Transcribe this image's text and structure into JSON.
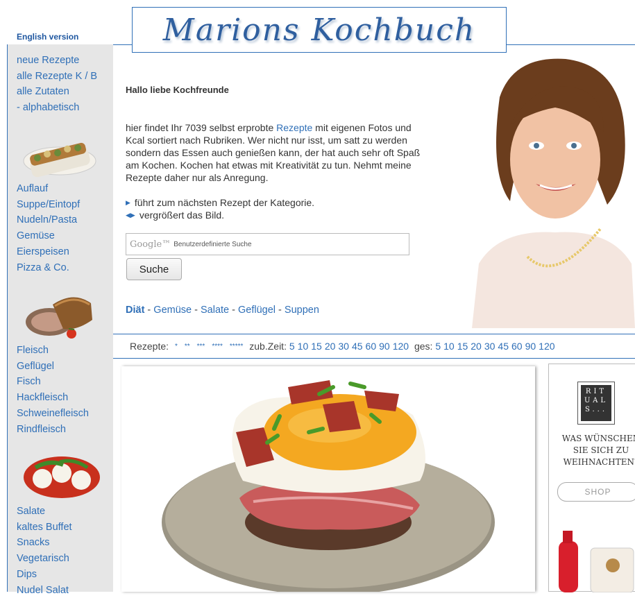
{
  "english_link": "English version",
  "logo_title": "Marions Kochbuch",
  "sidebar": {
    "group1": [
      "neue Rezepte",
      "alle Rezepte K / B",
      "alle Zutaten",
      "- alphabetisch"
    ],
    "group2": [
      "Auflauf",
      "Suppe/Eintopf",
      "Nudeln/Pasta",
      "Gemüse",
      "Eierspeisen",
      "Pizza & Co."
    ],
    "group3": [
      "Fleisch",
      "Geflügel",
      "Fisch",
      "Hackfleisch",
      "Schweinefleisch",
      "Rindfleisch"
    ],
    "group4": [
      "Salate",
      "kaltes Buffet",
      "Snacks",
      "Vegetarisch",
      "Dips",
      "Nudel Salat"
    ]
  },
  "main": {
    "greeting": "Hallo liebe Kochfreunde",
    "intro_before": "hier findet Ihr 7039 selbst erprobte ",
    "intro_link": "Rezepte",
    "intro_after": " mit eigenen Fotos und Kcal sortiert nach Rubriken. Wer nicht nur isst, um satt zu werden sondern das Essen auch genießen kann, der hat auch sehr oft Spaß am Kochen. Kochen hat etwas mit Kreativität zu tun. Nehmt meine Rezepte daher nur als Anregung.",
    "legend_next": "führt zum nächsten Rezept der Kategorie.",
    "legend_zoom": "vergrößert das Bild.",
    "search_brand": "Google™",
    "search_placeholder": "Benutzerdefinierte Suche",
    "search_button": "Suche",
    "categories": [
      "Diät",
      "Gemüse",
      "Salate",
      "Geflügel",
      "Suppen"
    ]
  },
  "filter": {
    "rezepte_label": "Rezepte:",
    "stars": [
      "*",
      "**",
      "***",
      "****",
      "*****"
    ],
    "zeit_label": "zub.Zeit:",
    "zeit_values": [
      "5",
      "10",
      "15",
      "20",
      "30",
      "45",
      "60",
      "90",
      "120"
    ],
    "ges_label": "ges:",
    "ges_values": [
      "5",
      "10",
      "15",
      "20",
      "30",
      "45",
      "60",
      "90",
      "120"
    ]
  },
  "ad": {
    "brand_letters": "RIT UAL S...",
    "text": "WAS WÜNSCHEN SIE SICH ZU WEIHNACHTEN?",
    "shop": "SHOP"
  },
  "colors": {
    "link": "#2f6fb7",
    "sidebar_bg": "#e6e6e6",
    "rule": "#2f6fb7"
  }
}
